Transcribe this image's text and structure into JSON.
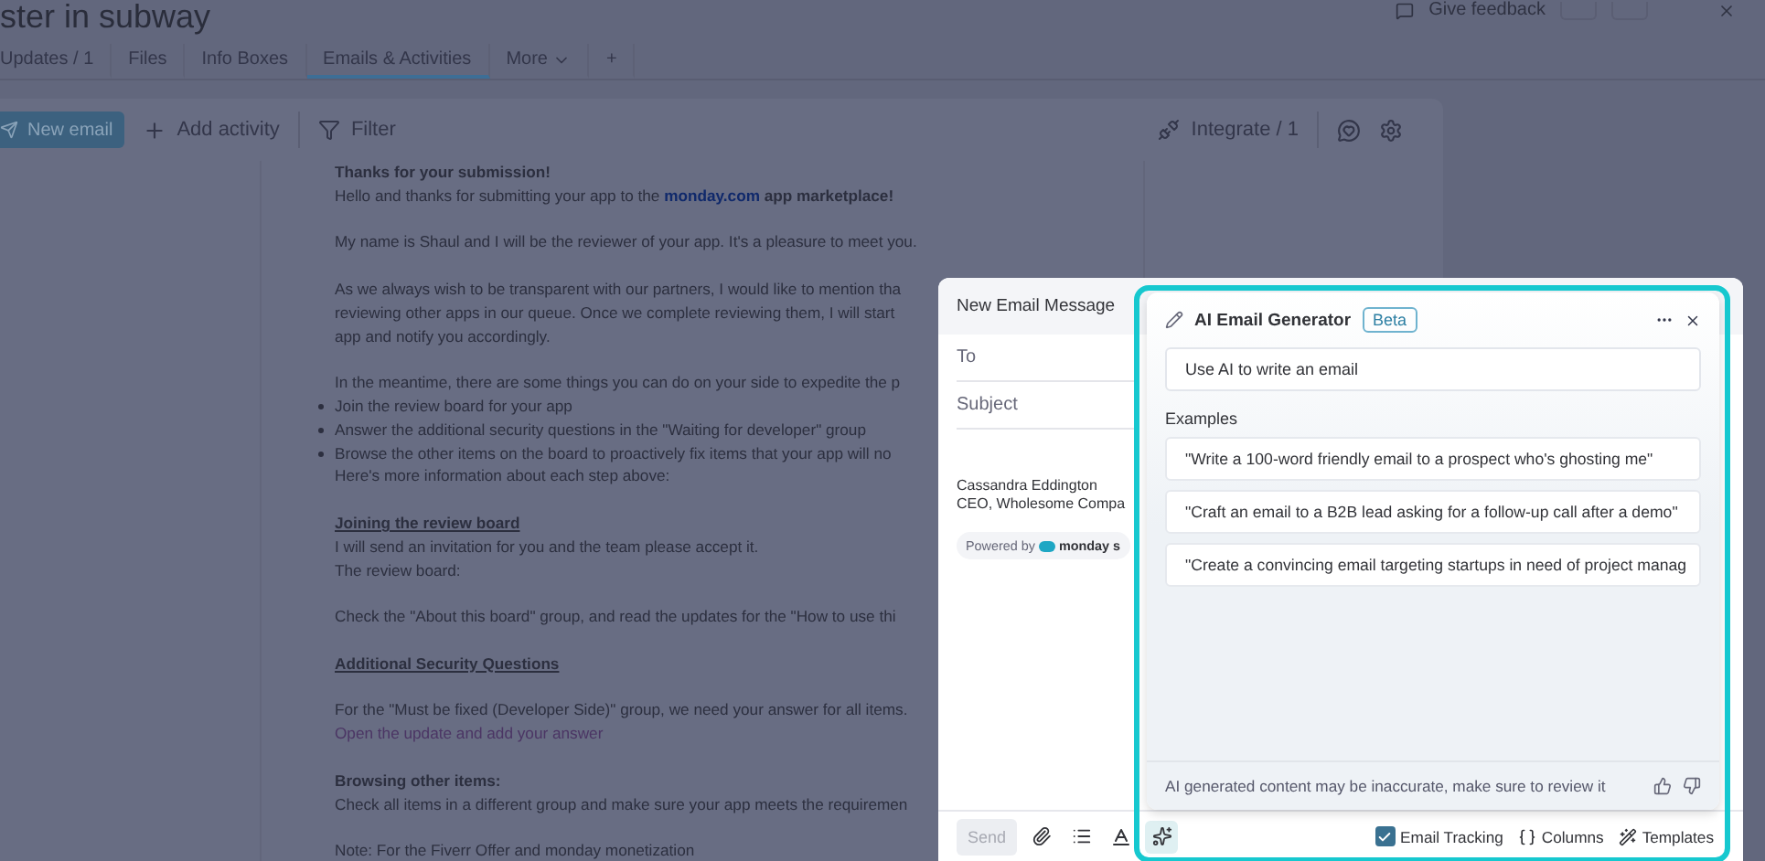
{
  "header": {
    "title": "ster in subway",
    "feedback": "Give feedback"
  },
  "tabs": [
    {
      "label": "Updates / 1",
      "selected": false,
      "kind": "tab"
    },
    {
      "label": "Files",
      "selected": false,
      "kind": "tab"
    },
    {
      "label": "Info Boxes",
      "selected": false,
      "kind": "tab"
    },
    {
      "label": "Emails & Activities",
      "selected": true,
      "kind": "tab"
    },
    {
      "label": "More",
      "selected": false,
      "kind": "menu"
    },
    {
      "label": "+",
      "selected": false,
      "kind": "add"
    }
  ],
  "toolbar": {
    "new_email": "New email",
    "add_activity": "Add activity",
    "filter": "Filter",
    "integrate": "Integrate / 1"
  },
  "email_body": [
    [
      {
        "kind": "strong",
        "text": "Thanks for your submission!"
      },
      {
        "kind": "text",
        "text": "Hello and thanks for submitting your app to the ",
        "link": "monday.com",
        "after": " **app marketplace!**"
      }
    ],
    [
      {
        "kind": "text",
        "text": "My name is Shaul and I will be the reviewer of your app. It's a pleasure to meet you."
      }
    ],
    [
      {
        "kind": "text",
        "text": "As we always wish to be transparent with our partners, I would like to mention tha"
      },
      {
        "kind": "text",
        "text": "reviewing other apps in our queue. Once we complete reviewing them, I will start"
      },
      {
        "kind": "text",
        "text": "app and notify you accordingly."
      }
    ],
    [
      {
        "kind": "text",
        "text": "In the meantime, there are some things you can do on your side to expedite the p"
      },
      {
        "kind": "bullet",
        "text": "Join the review board for your app"
      },
      {
        "kind": "bullet",
        "text": "Answer the additional security questions in the \"Waiting for developer\" group"
      },
      {
        "kind": "bullet",
        "text": "Browse the other items on the board to proactively fix items that your app will no"
      },
      {
        "kind": "text",
        "text": "Here's more information about each step above:"
      }
    ],
    [
      {
        "kind": "heading",
        "text": "Joining the review board"
      },
      {
        "kind": "text",
        "text": "I will send an invitation for you and the team please accept it."
      },
      {
        "kind": "text",
        "text": "The review board:"
      }
    ],
    [
      {
        "kind": "text",
        "text": "Check the \"About this board\" group, and read the updates for the \"How to use thi"
      }
    ],
    [
      {
        "kind": "heading",
        "text": "Additional Security Questions"
      }
    ],
    [
      {
        "kind": "text",
        "text": "For the \"Must be fixed (Developer Side)\" group, we need your answer for all items."
      },
      {
        "kind": "link",
        "text": "Open the update and add your answer"
      }
    ],
    [
      {
        "kind": "strong",
        "text": "Browsing other items:"
      },
      {
        "kind": "text",
        "text": "Check all items in a different group and make sure your app meets the requiremen"
      }
    ],
    [
      {
        "kind": "text",
        "text": "Note: For the Fiverr Offer and monday monetization"
      }
    ]
  ],
  "compose": {
    "title": "New Email Message",
    "fields": [
      {
        "placeholder": "To"
      },
      {
        "placeholder": "Subject"
      }
    ],
    "signature": [
      "Cassandra Eddington",
      "CEO, Wholesome Compa"
    ],
    "powered_by": "Powered by",
    "brand": "monday s",
    "send": {
      "label": "Send",
      "disabled": true
    },
    "tools": [
      {
        "kind": "attach",
        "selected": false
      },
      {
        "kind": "list",
        "selected": false
      },
      {
        "kind": "text-color",
        "selected": false
      },
      {
        "kind": "ai",
        "selected": true
      }
    ],
    "tracking": {
      "label": "Email Tracking",
      "checked": true
    },
    "columns": "Columns",
    "templates": "Templates"
  },
  "ai_panel": {
    "title": "AI Email Generator",
    "badge": "Beta",
    "placeholder": "Use AI to write an email",
    "examples_label": "Examples",
    "examples": [
      "\"Write a 100-word friendly email to a prospect who's ghosting me\"",
      "\"Craft an email to a B2B lead asking for a follow-up call after a demo\"",
      "\"Create a convincing email targeting startups in need of project manag"
    ],
    "disclaimer": "AI generated content may be inaccurate, make sure to review it"
  }
}
